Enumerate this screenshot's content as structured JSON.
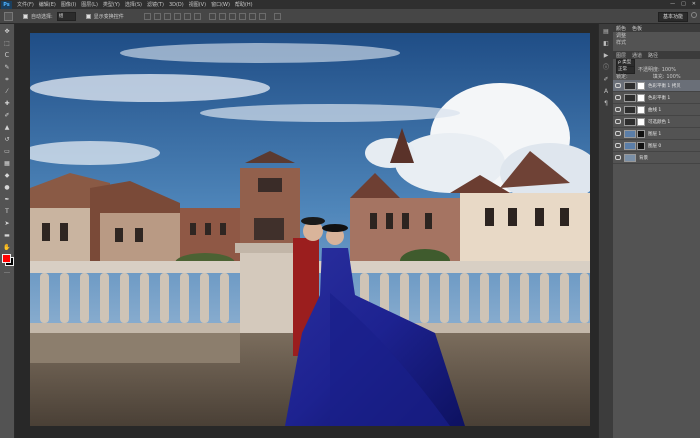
{
  "app": {
    "logo": "Ps"
  },
  "menu": [
    {
      "label": "文件(F)"
    },
    {
      "label": "编辑(E)"
    },
    {
      "label": "图像(I)"
    },
    {
      "label": "图层(L)"
    },
    {
      "label": "类型(Y)"
    },
    {
      "label": "选择(S)"
    },
    {
      "label": "滤镜(T)"
    },
    {
      "label": "3D(D)"
    },
    {
      "label": "视图(V)"
    },
    {
      "label": "窗口(W)"
    },
    {
      "label": "帮助(H)"
    }
  ],
  "window_controls": {
    "minimize": "—",
    "maximize": "□",
    "close": "✕"
  },
  "options": {
    "auto_select_label": "自动选择:",
    "auto_select_value": "组",
    "show_transform_label": "显示变换控件",
    "workspace": "基本功能"
  },
  "tools": [
    {
      "icon": "move-tool-icon",
      "glyph": "✥"
    },
    {
      "icon": "marquee-tool-icon",
      "glyph": "⬚"
    },
    {
      "icon": "lasso-tool-icon",
      "glyph": "ᑕ"
    },
    {
      "icon": "quick-select-tool-icon",
      "glyph": "✎"
    },
    {
      "icon": "crop-tool-icon",
      "glyph": "⌗"
    },
    {
      "icon": "eyedropper-tool-icon",
      "glyph": "⁄"
    },
    {
      "icon": "healing-brush-tool-icon",
      "glyph": "✚"
    },
    {
      "icon": "brush-tool-icon",
      "glyph": "✐"
    },
    {
      "icon": "clone-stamp-tool-icon",
      "glyph": "▲"
    },
    {
      "icon": "history-brush-tool-icon",
      "glyph": "↺"
    },
    {
      "icon": "eraser-tool-icon",
      "glyph": "▭"
    },
    {
      "icon": "gradient-tool-icon",
      "glyph": "▦"
    },
    {
      "icon": "blur-tool-icon",
      "glyph": "◆"
    },
    {
      "icon": "dodge-tool-icon",
      "glyph": "●"
    },
    {
      "icon": "pen-tool-icon",
      "glyph": "✒"
    },
    {
      "icon": "type-tool-icon",
      "glyph": "T"
    },
    {
      "icon": "path-select-tool-icon",
      "glyph": "➤"
    },
    {
      "icon": "shape-tool-icon",
      "glyph": "▬"
    },
    {
      "icon": "hand-tool-icon",
      "glyph": "✋"
    },
    {
      "icon": "zoom-tool-icon",
      "glyph": "⚲"
    },
    {
      "icon": "edit-toolbar-icon",
      "glyph": "…"
    }
  ],
  "colors": {
    "foreground": "#ff0000",
    "background": "#000000"
  },
  "minibar": [
    {
      "icon": "history-panel-icon",
      "glyph": "▤"
    },
    {
      "icon": "properties-panel-icon",
      "glyph": "◧"
    },
    {
      "icon": "actions-panel-icon",
      "glyph": "▶"
    },
    {
      "icon": "info-panel-icon",
      "glyph": "ⓘ"
    },
    {
      "icon": "brush-panel-icon",
      "glyph": "✐"
    },
    {
      "icon": "character-panel-icon",
      "glyph": "A"
    },
    {
      "icon": "paragraph-panel-icon",
      "glyph": "¶"
    }
  ],
  "panels": {
    "top_tabs": [
      "颜色",
      "色板"
    ],
    "row2": "调整",
    "row3": "样式",
    "layers_tabs": [
      "图层",
      "通道",
      "路径"
    ],
    "kind_label": "ρ 类型",
    "blend_mode": "正常",
    "opacity_label": "不透明度:",
    "opacity_value": "100%",
    "lock_label": "锁定:",
    "fill_label": "填充:",
    "fill_value": "100%",
    "layers": [
      {
        "name": "色彩平衡 1 拷贝",
        "selected": true
      },
      {
        "name": "色彩平衡 1",
        "selected": false
      },
      {
        "name": "曲线 1",
        "selected": false
      },
      {
        "name": "可选颜色 1",
        "selected": false
      },
      {
        "name": "图层 1",
        "selected": false
      },
      {
        "name": "图层 0",
        "selected": false
      },
      {
        "name": "背景",
        "selected": false
      }
    ]
  }
}
